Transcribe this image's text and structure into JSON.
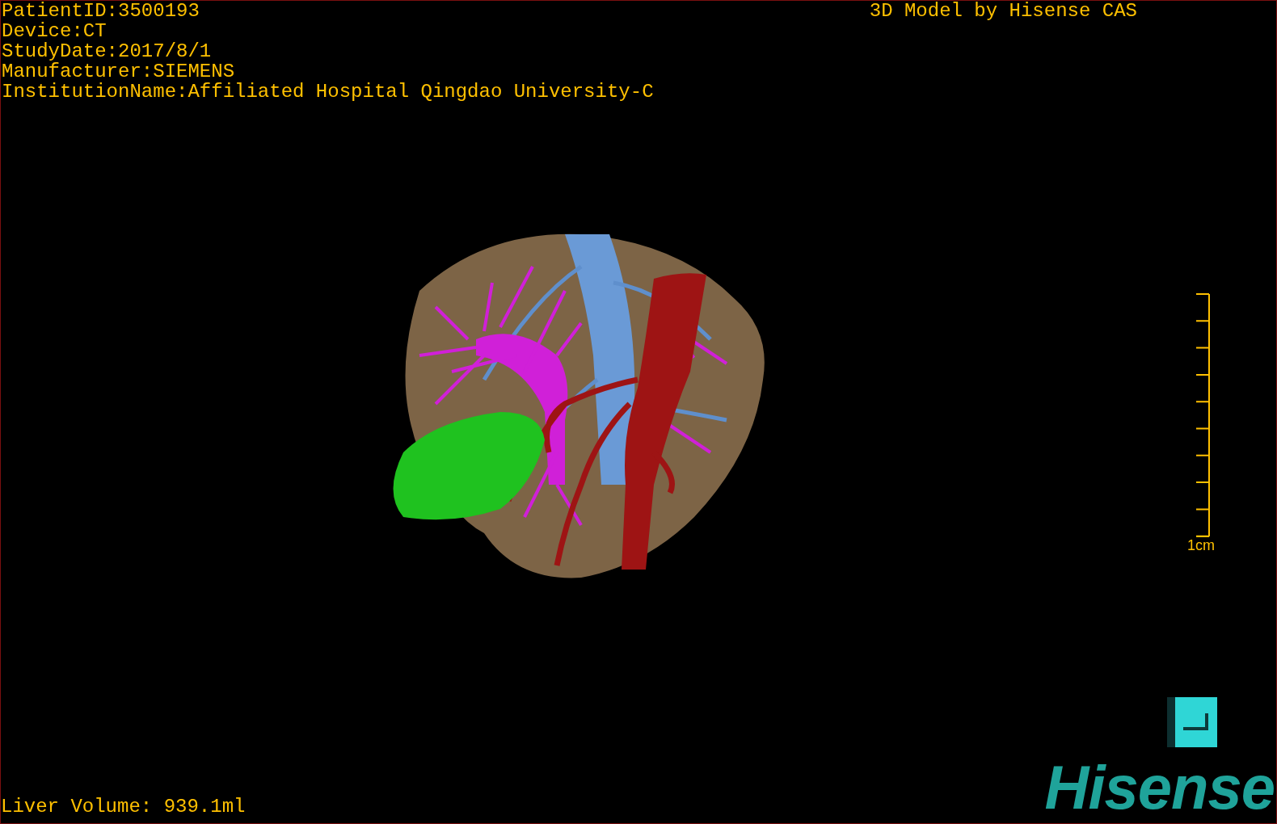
{
  "patient_info": [
    "PatientID:3500193",
    "Device:CT",
    "StudyDate:2017/8/1",
    "Manufacturer:SIEMENS",
    "InstitutionName:Affiliated Hospital Qingdao University-C"
  ],
  "title": "3D Model by Hisense CAS",
  "scale_bar": {
    "label": "1cm"
  },
  "liver_volume": "Liver Volume: 939.1ml",
  "logo": "Hisense"
}
